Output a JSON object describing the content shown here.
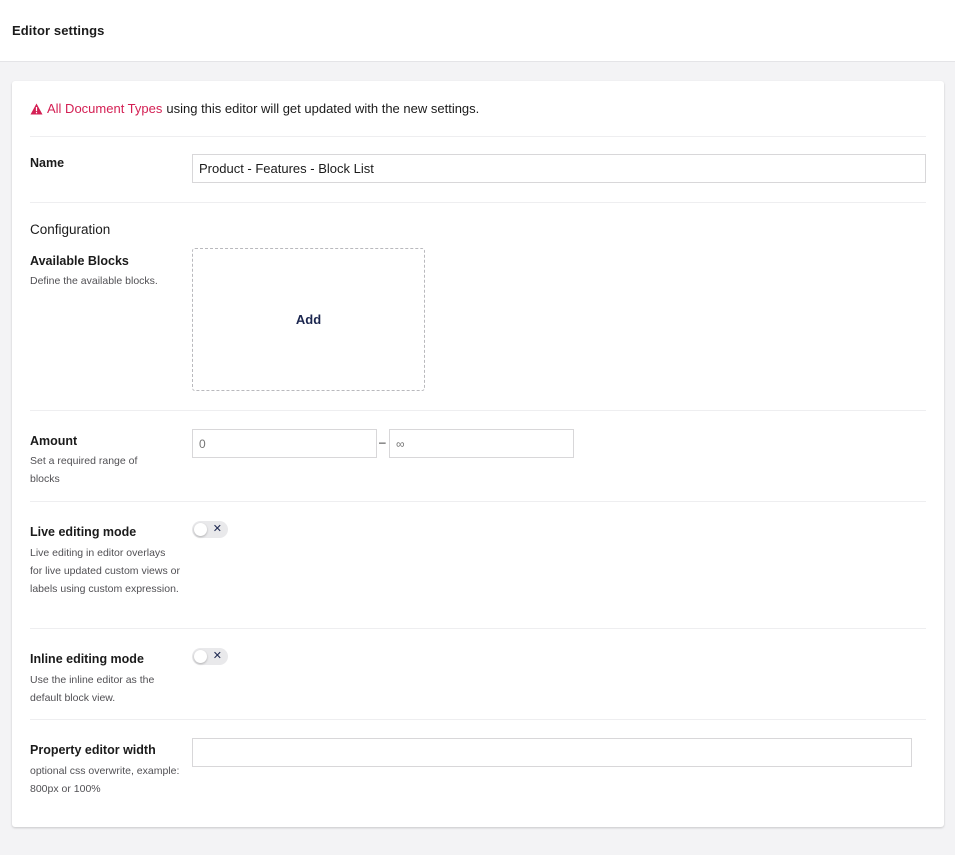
{
  "header": {
    "title": "Editor settings"
  },
  "notice": {
    "icon": "alert-triangle-icon",
    "highlight": "All Document Types",
    "text": "using this editor will get updated with the new settings.",
    "highlight_color": "#d42054"
  },
  "fields": {
    "name": {
      "label": "Name",
      "value": "Product - Features - Block List"
    },
    "configuration_heading": "Configuration",
    "available_blocks": {
      "label": "Available Blocks",
      "description": "Define the available blocks.",
      "add_label": "Add"
    },
    "amount": {
      "label": "Amount",
      "description": "Set a required range of blocks",
      "min_placeholder": "0",
      "separator": "–",
      "max_placeholder": "∞"
    },
    "live_editing": {
      "label": "Live editing mode",
      "description": "Live editing in editor overlays for live updated custom views or labels using custom expression.",
      "enabled": false
    },
    "inline_editing": {
      "label": "Inline editing mode",
      "description": "Use the inline editor as the default block view.",
      "enabled": false
    },
    "property_editor_width": {
      "label": "Property editor width",
      "description": "optional css overwrite, example: 800px or 100%",
      "value": ""
    }
  },
  "colors": {
    "accent": "#d42054",
    "text_primary": "#1b264f",
    "background": "#f3f3f5"
  }
}
